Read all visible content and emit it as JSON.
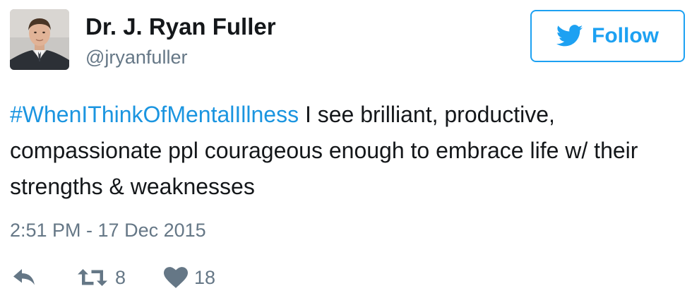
{
  "user": {
    "name": "Dr. J. Ryan Fuller",
    "handle": "@jryanfuller"
  },
  "follow_button": {
    "label": "Follow"
  },
  "tweet": {
    "hashtag": "#WhenIThinkOfMentalIllness",
    "text": " I see brilliant, productive, compassionate ppl courageous enough to embrace life w/ their strengths & weaknesses",
    "timestamp": "2:51 PM - 17 Dec 2015"
  },
  "actions": {
    "reply_icon": "reply-icon",
    "retweet_count": "8",
    "like_count": "18"
  },
  "colors": {
    "accent": "#1da1f2",
    "hashtag": "#1b95e0",
    "secondary_text": "#657786"
  }
}
